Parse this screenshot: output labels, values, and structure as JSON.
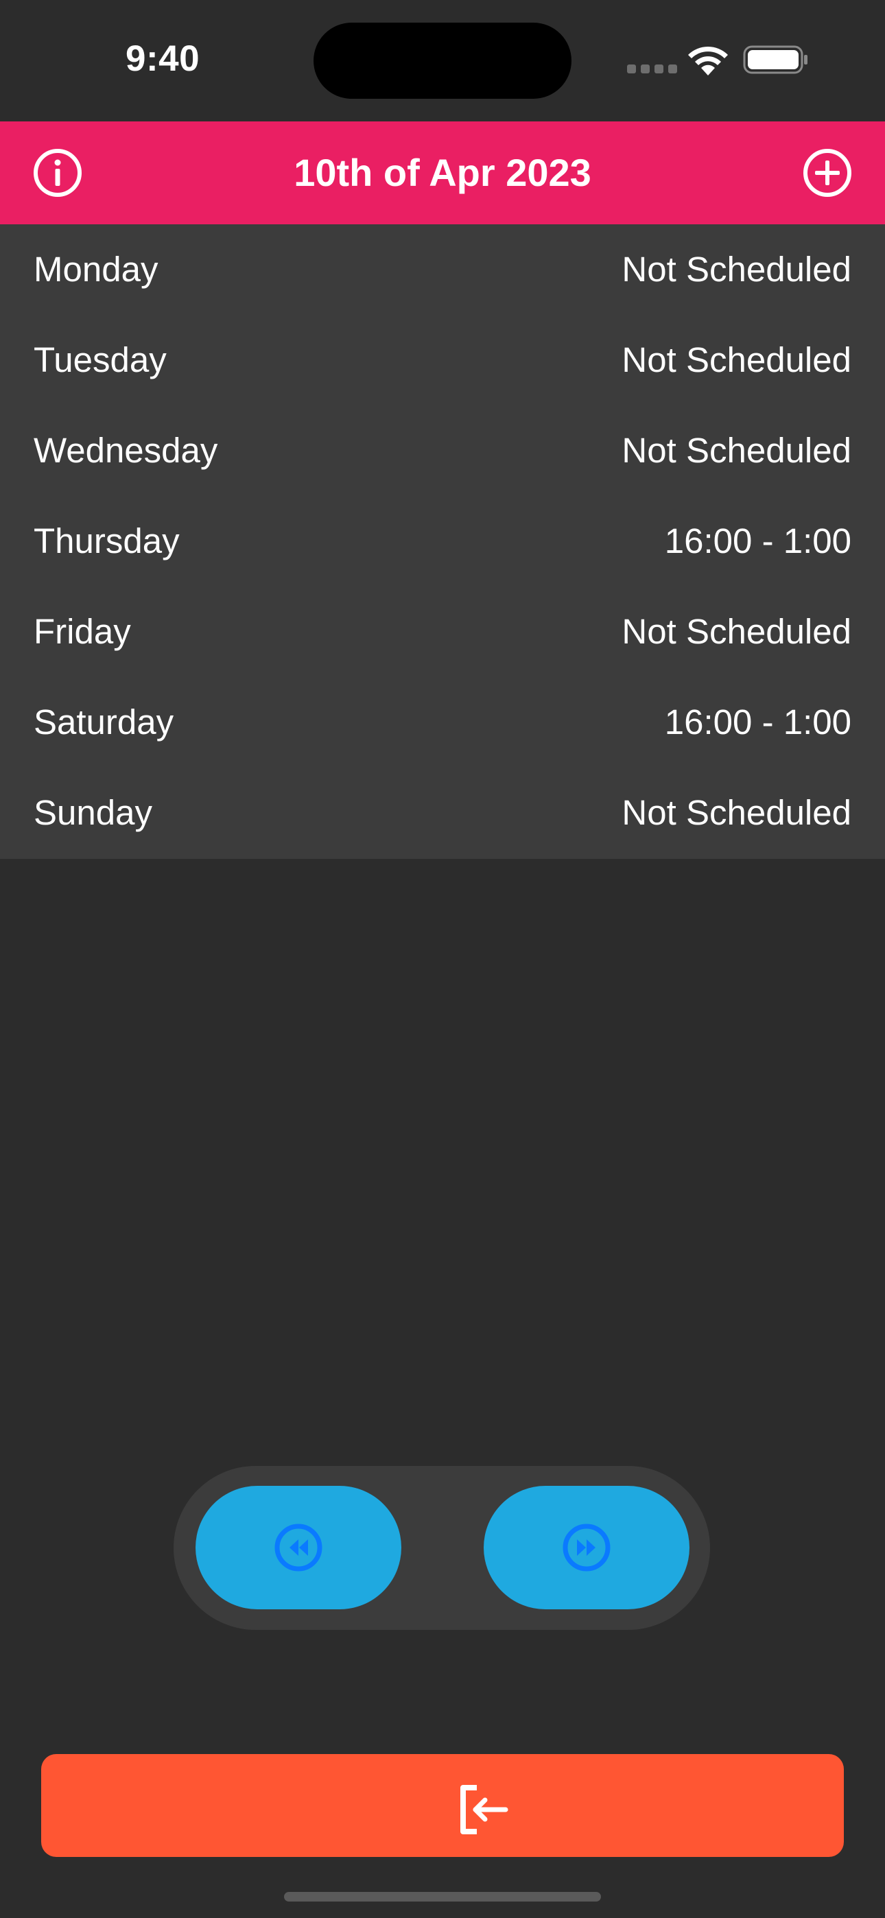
{
  "status_bar": {
    "time": "9:40"
  },
  "header": {
    "title": "10th of Apr 2023",
    "background_color": "#ea1f63",
    "left_icon": "info-icon",
    "right_icon": "plus-circle-icon"
  },
  "schedule": [
    {
      "day": "Monday",
      "time": "Not Scheduled"
    },
    {
      "day": "Tuesday",
      "time": "Not Scheduled"
    },
    {
      "day": "Wednesday",
      "time": "Not Scheduled"
    },
    {
      "day": "Thursday",
      "time": "16:00 - 1:00"
    },
    {
      "day": "Friday",
      "time": "Not Scheduled"
    },
    {
      "day": "Saturday",
      "time": "16:00 - 1:00"
    },
    {
      "day": "Sunday",
      "time": "Not Scheduled"
    }
  ],
  "navigation": {
    "button_color": "#1fa9e0",
    "icon_color": "#0a7aff",
    "prev_icon": "rewind-circle-icon",
    "next_icon": "fast-forward-circle-icon"
  },
  "logout": {
    "button_color": "#ff5633",
    "icon": "logout-icon"
  },
  "colors": {
    "background": "#2c2c2c",
    "list_background": "#3c3c3c"
  }
}
